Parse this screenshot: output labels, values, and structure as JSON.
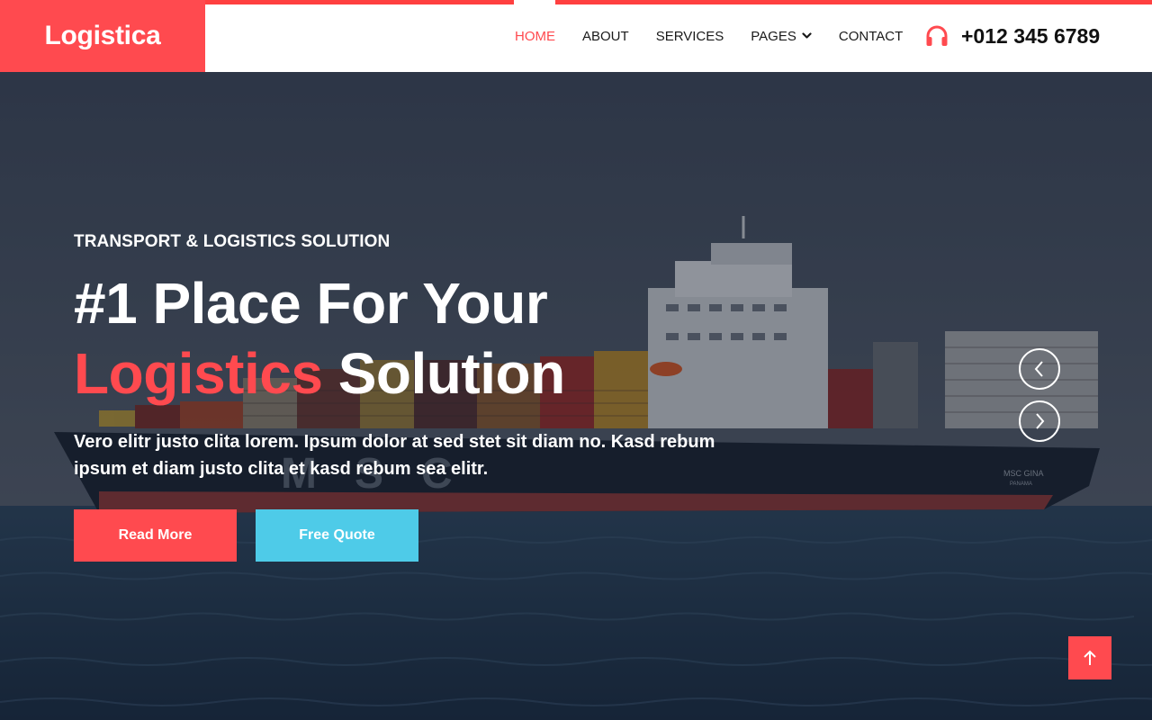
{
  "brand": {
    "name": "Logistica"
  },
  "nav": {
    "items": [
      {
        "label": "HOME",
        "active": true
      },
      {
        "label": "ABOUT"
      },
      {
        "label": "SERVICES"
      },
      {
        "label": "PAGES",
        "dropdown": true
      },
      {
        "label": "CONTACT"
      }
    ],
    "phone": "+012 345 6789",
    "phone_icon": "headphones-icon"
  },
  "hero": {
    "subtitle": "TRANSPORT & LOGISTICS SOLUTION",
    "headline_line1": "#1 Place For Your",
    "headline_accent": "Logistics",
    "headline_rest": " Solution",
    "description": "Vero elitr justo clita lorem. Ipsum dolor at sed stet sit diam no. Kasd rebum ipsum et diam justo clita et kasd rebum sea elitr.",
    "buttons": {
      "read_more": "Read More",
      "free_quote": "Free Quote"
    },
    "ship_hull_text": "MSC",
    "ship_name": "MSC GINA",
    "ship_port": "PANAMA"
  },
  "colors": {
    "accent": "#ff4a4f",
    "secondary": "#4ecbe8",
    "nav_text": "#1a1a1a"
  }
}
